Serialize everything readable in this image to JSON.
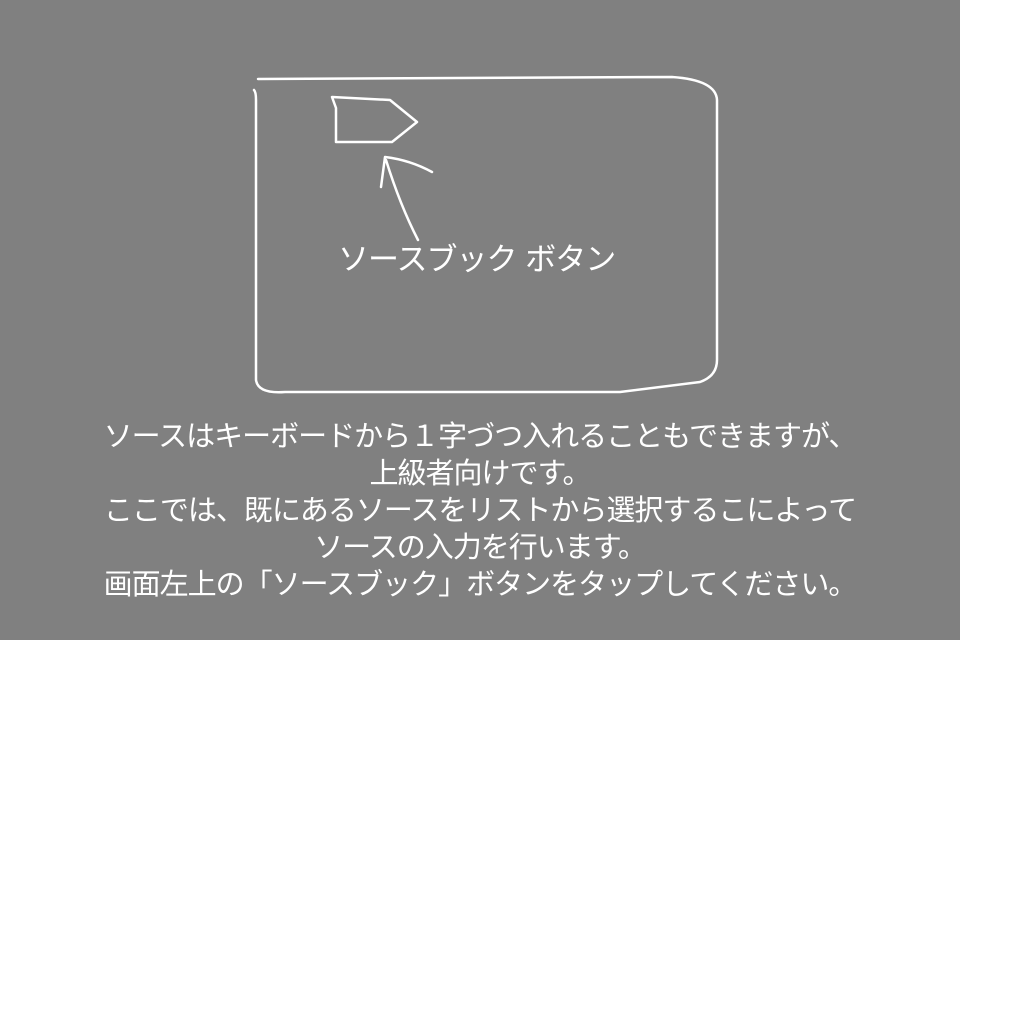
{
  "colors": {
    "panel_background": "#808080",
    "page_background": "#ffffff",
    "sketch_stroke": "#ffffff",
    "text": "#ffffff"
  },
  "diagram": {
    "button_label": "ソースブック ボタン",
    "icons": [
      "tablet-frame-sketch",
      "sourcebook-button-icon",
      "pointer-arrow-icon"
    ]
  },
  "instructions": {
    "lines": [
      "ソースはキーボードから１字づつ入れることもできますが、",
      "上級者向けです。",
      "ここでは、既にあるソースをリストから選択するこによって",
      "ソースの入力を行います。",
      "画面左上の「ソースブック」ボタンをタップしてください。"
    ]
  }
}
